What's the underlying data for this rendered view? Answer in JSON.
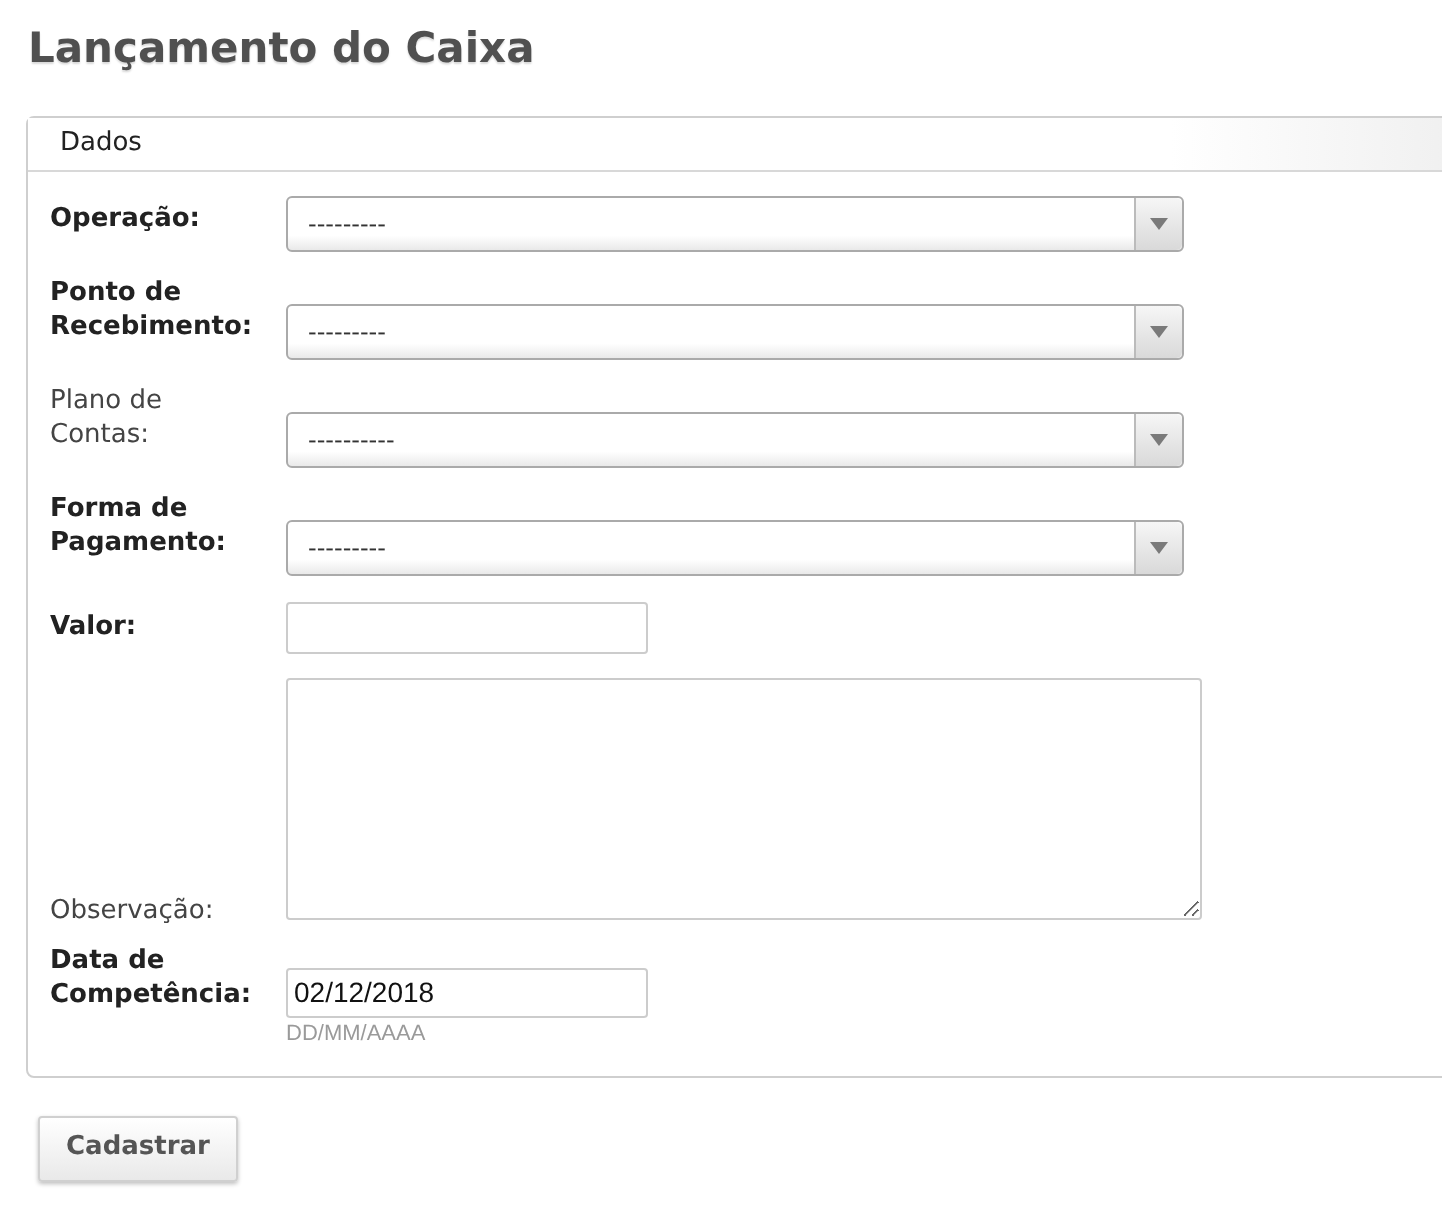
{
  "page": {
    "title": "Lançamento do Caixa"
  },
  "panel": {
    "title": "Dados",
    "fields": [
      {
        "kind": "select",
        "label": "Operação:",
        "required": true,
        "value": "---------"
      },
      {
        "kind": "select",
        "label": "Ponto de Recebimento:",
        "required": true,
        "value": "---------"
      },
      {
        "kind": "select",
        "label": "Plano de Contas:",
        "required": false,
        "value": "----------"
      },
      {
        "kind": "select",
        "label": "Forma de Pagamento:",
        "required": true,
        "value": "---------"
      },
      {
        "kind": "text",
        "label": "Valor:",
        "required": true
      },
      {
        "kind": "textarea",
        "label": "Observação:",
        "required": false
      },
      {
        "kind": "date",
        "label": "Data de Competência:",
        "required": true,
        "value": "02/12/2018",
        "hint": "DD/MM/AAAA"
      }
    ]
  },
  "buttons": [
    {
      "label": "Cadastrar"
    }
  ]
}
